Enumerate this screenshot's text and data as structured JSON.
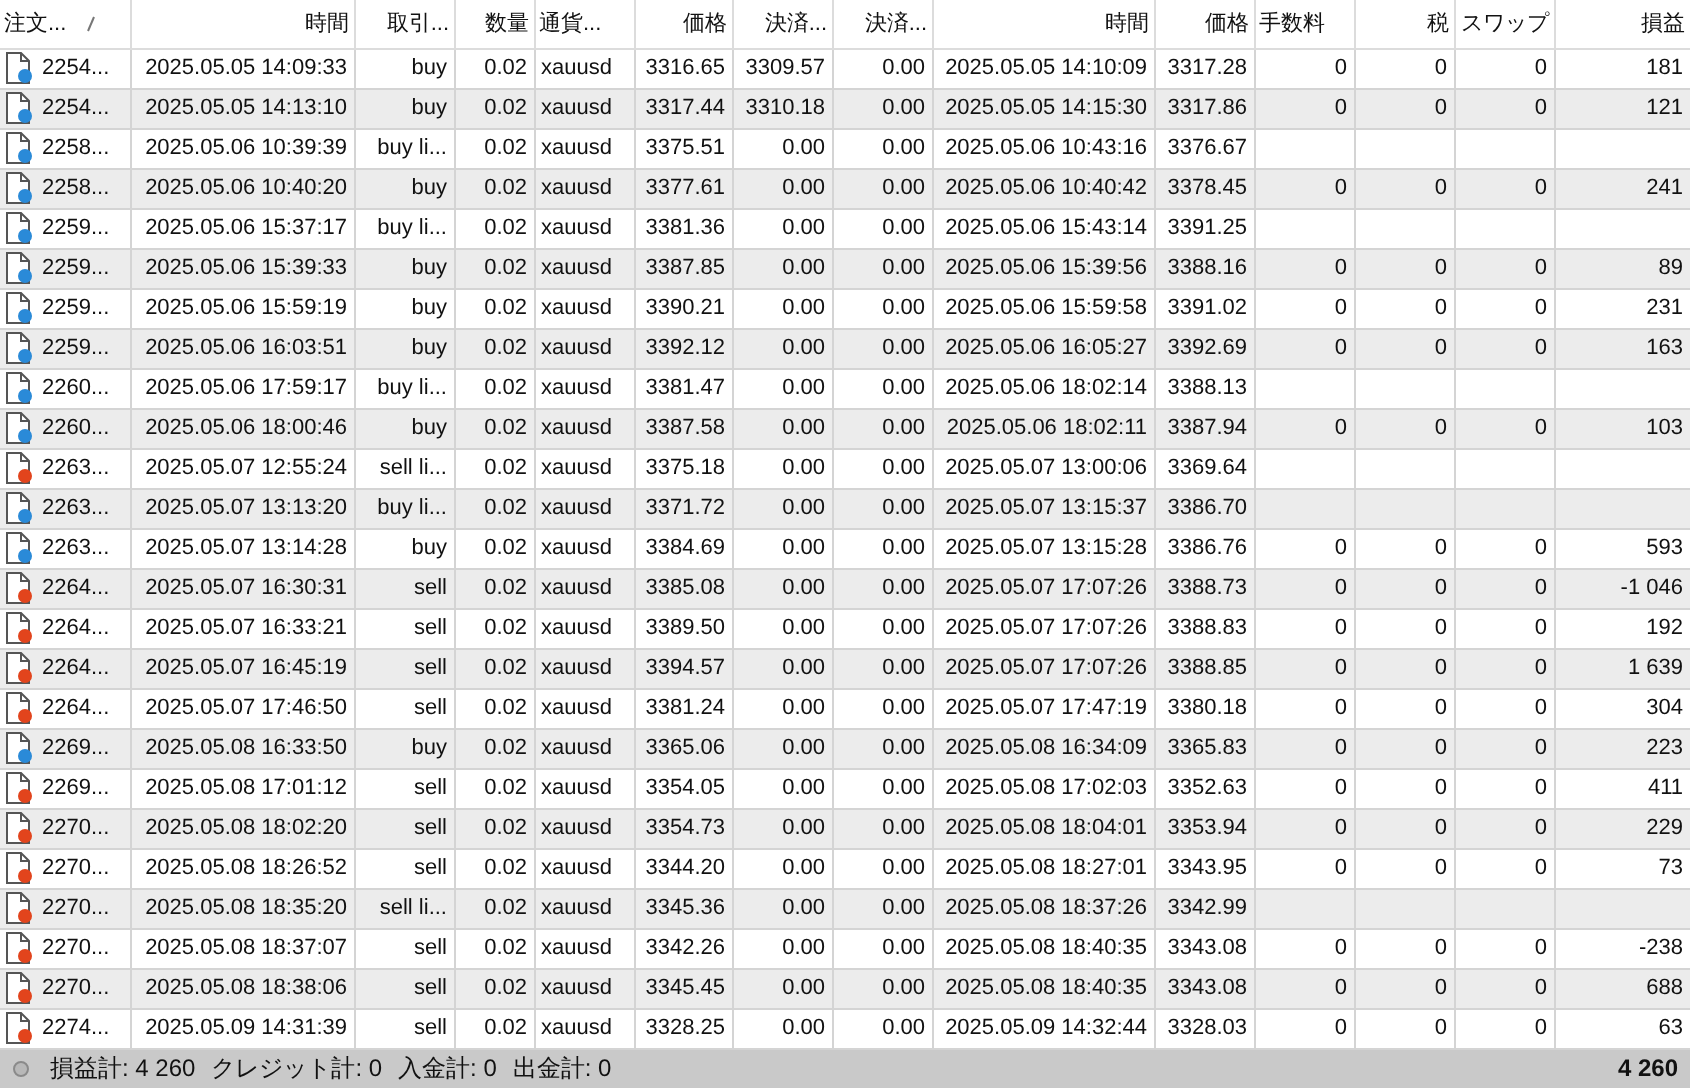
{
  "table": {
    "columns": [
      {
        "label": "注文...",
        "sorted": true
      },
      {
        "label": "時間",
        "sorted": false
      },
      {
        "label": "取引...",
        "sorted": false
      },
      {
        "label": "数量",
        "sorted": false
      },
      {
        "label": "通貨...",
        "sorted": false
      },
      {
        "label": "価格",
        "sorted": false
      },
      {
        "label": "決済...",
        "sorted": false
      },
      {
        "label": "決済...",
        "sorted": false
      },
      {
        "label": "時間",
        "sorted": false
      },
      {
        "label": "価格",
        "sorted": false
      },
      {
        "label": "手数料",
        "sorted": false
      },
      {
        "label": "税",
        "sorted": false
      },
      {
        "label": "スワップ",
        "sorted": false
      },
      {
        "label": "損益",
        "sorted": false
      }
    ],
    "rows": [
      {
        "kind": "buy",
        "order": "2254...",
        "time": "2025.05.05 14:09:33",
        "type": "buy",
        "volume": "0.02",
        "symbol": "xauusd",
        "price": "3316.65",
        "sl": "3309.57",
        "tp": "0.00",
        "close_time": "2025.05.05 14:10:09",
        "close_price": "3317.28",
        "commission": "0",
        "tax": "0",
        "swap": "0",
        "profit": "181"
      },
      {
        "kind": "buy",
        "order": "2254...",
        "time": "2025.05.05 14:13:10",
        "type": "buy",
        "volume": "0.02",
        "symbol": "xauusd",
        "price": "3317.44",
        "sl": "3310.18",
        "tp": "0.00",
        "close_time": "2025.05.05 14:15:30",
        "close_price": "3317.86",
        "commission": "0",
        "tax": "0",
        "swap": "0",
        "profit": "121"
      },
      {
        "kind": "buy",
        "order": "2258...",
        "time": "2025.05.06 10:39:39",
        "type": "buy li...",
        "volume": "0.02",
        "symbol": "xauusd",
        "price": "3375.51",
        "sl": "0.00",
        "tp": "0.00",
        "close_time": "2025.05.06 10:43:16",
        "close_price": "3376.67"
      },
      {
        "kind": "buy",
        "order": "2258...",
        "time": "2025.05.06 10:40:20",
        "type": "buy",
        "volume": "0.02",
        "symbol": "xauusd",
        "price": "3377.61",
        "sl": "0.00",
        "tp": "0.00",
        "close_time": "2025.05.06 10:40:42",
        "close_price": "3378.45",
        "commission": "0",
        "tax": "0",
        "swap": "0",
        "profit": "241"
      },
      {
        "kind": "buy",
        "order": "2259...",
        "time": "2025.05.06 15:37:17",
        "type": "buy li...",
        "volume": "0.02",
        "symbol": "xauusd",
        "price": "3381.36",
        "sl": "0.00",
        "tp": "0.00",
        "close_time": "2025.05.06 15:43:14",
        "close_price": "3391.25"
      },
      {
        "kind": "buy",
        "order": "2259...",
        "time": "2025.05.06 15:39:33",
        "type": "buy",
        "volume": "0.02",
        "symbol": "xauusd",
        "price": "3387.85",
        "sl": "0.00",
        "tp": "0.00",
        "close_time": "2025.05.06 15:39:56",
        "close_price": "3388.16",
        "commission": "0",
        "tax": "0",
        "swap": "0",
        "profit": "89"
      },
      {
        "kind": "buy",
        "order": "2259...",
        "time": "2025.05.06 15:59:19",
        "type": "buy",
        "volume": "0.02",
        "symbol": "xauusd",
        "price": "3390.21",
        "sl": "0.00",
        "tp": "0.00",
        "close_time": "2025.05.06 15:59:58",
        "close_price": "3391.02",
        "commission": "0",
        "tax": "0",
        "swap": "0",
        "profit": "231"
      },
      {
        "kind": "buy",
        "order": "2259...",
        "time": "2025.05.06 16:03:51",
        "type": "buy",
        "volume": "0.02",
        "symbol": "xauusd",
        "price": "3392.12",
        "sl": "0.00",
        "tp": "0.00",
        "close_time": "2025.05.06 16:05:27",
        "close_price": "3392.69",
        "commission": "0",
        "tax": "0",
        "swap": "0",
        "profit": "163"
      },
      {
        "kind": "buy",
        "order": "2260...",
        "time": "2025.05.06 17:59:17",
        "type": "buy li...",
        "volume": "0.02",
        "symbol": "xauusd",
        "price": "3381.47",
        "sl": "0.00",
        "tp": "0.00",
        "close_time": "2025.05.06 18:02:14",
        "close_price": "3388.13"
      },
      {
        "kind": "buy",
        "order": "2260...",
        "time": "2025.05.06 18:00:46",
        "type": "buy",
        "volume": "0.02",
        "symbol": "xauusd",
        "price": "3387.58",
        "sl": "0.00",
        "tp": "0.00",
        "close_time": "2025.05.06 18:02:11",
        "close_price": "3387.94",
        "commission": "0",
        "tax": "0",
        "swap": "0",
        "profit": "103"
      },
      {
        "kind": "sell",
        "order": "2263...",
        "time": "2025.05.07 12:55:24",
        "type": "sell li...",
        "volume": "0.02",
        "symbol": "xauusd",
        "price": "3375.18",
        "sl": "0.00",
        "tp": "0.00",
        "close_time": "2025.05.07 13:00:06",
        "close_price": "3369.64"
      },
      {
        "kind": "buy",
        "order": "2263...",
        "time": "2025.05.07 13:13:20",
        "type": "buy li...",
        "volume": "0.02",
        "symbol": "xauusd",
        "price": "3371.72",
        "sl": "0.00",
        "tp": "0.00",
        "close_time": "2025.05.07 13:15:37",
        "close_price": "3386.70"
      },
      {
        "kind": "buy",
        "order": "2263...",
        "time": "2025.05.07 13:14:28",
        "type": "buy",
        "volume": "0.02",
        "symbol": "xauusd",
        "price": "3384.69",
        "sl": "0.00",
        "tp": "0.00",
        "close_time": "2025.05.07 13:15:28",
        "close_price": "3386.76",
        "commission": "0",
        "tax": "0",
        "swap": "0",
        "profit": "593"
      },
      {
        "kind": "sell",
        "order": "2264...",
        "time": "2025.05.07 16:30:31",
        "type": "sell",
        "volume": "0.02",
        "symbol": "xauusd",
        "price": "3385.08",
        "sl": "0.00",
        "tp": "0.00",
        "close_time": "2025.05.07 17:07:26",
        "close_price": "3388.73",
        "commission": "0",
        "tax": "0",
        "swap": "0",
        "profit": "-1 046"
      },
      {
        "kind": "sell",
        "order": "2264...",
        "time": "2025.05.07 16:33:21",
        "type": "sell",
        "volume": "0.02",
        "symbol": "xauusd",
        "price": "3389.50",
        "sl": "0.00",
        "tp": "0.00",
        "close_time": "2025.05.07 17:07:26",
        "close_price": "3388.83",
        "commission": "0",
        "tax": "0",
        "swap": "0",
        "profit": "192"
      },
      {
        "kind": "sell",
        "order": "2264...",
        "time": "2025.05.07 16:45:19",
        "type": "sell",
        "volume": "0.02",
        "symbol": "xauusd",
        "price": "3394.57",
        "sl": "0.00",
        "tp": "0.00",
        "close_time": "2025.05.07 17:07:26",
        "close_price": "3388.85",
        "commission": "0",
        "tax": "0",
        "swap": "0",
        "profit": "1 639"
      },
      {
        "kind": "sell",
        "order": "2264...",
        "time": "2025.05.07 17:46:50",
        "type": "sell",
        "volume": "0.02",
        "symbol": "xauusd",
        "price": "3381.24",
        "sl": "0.00",
        "tp": "0.00",
        "close_time": "2025.05.07 17:47:19",
        "close_price": "3380.18",
        "commission": "0",
        "tax": "0",
        "swap": "0",
        "profit": "304"
      },
      {
        "kind": "buy",
        "order": "2269...",
        "time": "2025.05.08 16:33:50",
        "type": "buy",
        "volume": "0.02",
        "symbol": "xauusd",
        "price": "3365.06",
        "sl": "0.00",
        "tp": "0.00",
        "close_time": "2025.05.08 16:34:09",
        "close_price": "3365.83",
        "commission": "0",
        "tax": "0",
        "swap": "0",
        "profit": "223"
      },
      {
        "kind": "sell",
        "order": "2269...",
        "time": "2025.05.08 17:01:12",
        "type": "sell",
        "volume": "0.02",
        "symbol": "xauusd",
        "price": "3354.05",
        "sl": "0.00",
        "tp": "0.00",
        "close_time": "2025.05.08 17:02:03",
        "close_price": "3352.63",
        "commission": "0",
        "tax": "0",
        "swap": "0",
        "profit": "411"
      },
      {
        "kind": "sell",
        "order": "2270...",
        "time": "2025.05.08 18:02:20",
        "type": "sell",
        "volume": "0.02",
        "symbol": "xauusd",
        "price": "3354.73",
        "sl": "0.00",
        "tp": "0.00",
        "close_time": "2025.05.08 18:04:01",
        "close_price": "3353.94",
        "commission": "0",
        "tax": "0",
        "swap": "0",
        "profit": "229"
      },
      {
        "kind": "sell",
        "order": "2270...",
        "time": "2025.05.08 18:26:52",
        "type": "sell",
        "volume": "0.02",
        "symbol": "xauusd",
        "price": "3344.20",
        "sl": "0.00",
        "tp": "0.00",
        "close_time": "2025.05.08 18:27:01",
        "close_price": "3343.95",
        "commission": "0",
        "tax": "0",
        "swap": "0",
        "profit": "73"
      },
      {
        "kind": "sell",
        "order": "2270...",
        "time": "2025.05.08 18:35:20",
        "type": "sell li...",
        "volume": "0.02",
        "symbol": "xauusd",
        "price": "3345.36",
        "sl": "0.00",
        "tp": "0.00",
        "close_time": "2025.05.08 18:37:26",
        "close_price": "3342.99"
      },
      {
        "kind": "sell",
        "order": "2270...",
        "time": "2025.05.08 18:37:07",
        "type": "sell",
        "volume": "0.02",
        "symbol": "xauusd",
        "price": "3342.26",
        "sl": "0.00",
        "tp": "0.00",
        "close_time": "2025.05.08 18:40:35",
        "close_price": "3343.08",
        "commission": "0",
        "tax": "0",
        "swap": "0",
        "profit": "-238"
      },
      {
        "kind": "sell",
        "order": "2270...",
        "time": "2025.05.08 18:38:06",
        "type": "sell",
        "volume": "0.02",
        "symbol": "xauusd",
        "price": "3345.45",
        "sl": "0.00",
        "tp": "0.00",
        "close_time": "2025.05.08 18:40:35",
        "close_price": "3343.08",
        "commission": "0",
        "tax": "0",
        "swap": "0",
        "profit": "688"
      },
      {
        "kind": "sell",
        "order": "2274...",
        "time": "2025.05.09 14:31:39",
        "type": "sell",
        "volume": "0.02",
        "symbol": "xauusd",
        "price": "3328.25",
        "sl": "0.00",
        "tp": "0.00",
        "close_time": "2025.05.09 14:32:44",
        "close_price": "3328.03",
        "commission": "0",
        "tax": "0",
        "swap": "0",
        "profit": "63"
      }
    ]
  },
  "status_bar": {
    "totals": [
      "損益計: 4 260",
      "クレジット計: 0",
      "入金計: 0",
      "出金計: 0"
    ],
    "total_profit": "4 260"
  }
}
